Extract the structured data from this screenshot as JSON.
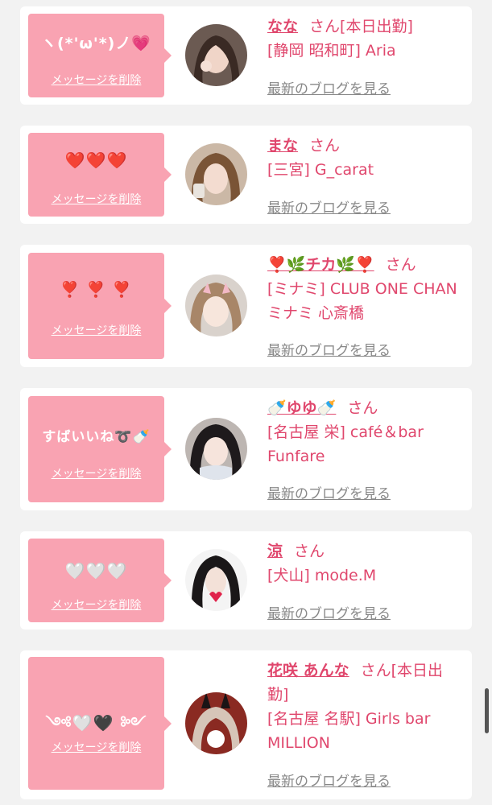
{
  "cards": [
    {
      "message": "ヽ(*'ω'*)ノ💗",
      "delete_label": "メッセージを削除",
      "name": "なな",
      "honorific": "さん",
      "status": "[本日出勤]",
      "shop": "[静岡 昭和町] Aria",
      "blog_label": "最新のブログを見る",
      "avatar_icon": "avatar-photo"
    },
    {
      "message": "❤️❤️❤️",
      "delete_label": "メッセージを削除",
      "name": "まな",
      "honorific": "さん",
      "status": "",
      "shop": "[三宮] G_carat",
      "blog_label": "最新のブログを見る",
      "avatar_icon": "avatar-photo"
    },
    {
      "message": "❣️ ❣️ ❣️",
      "delete_label": "メッセージを削除",
      "name": "❣️🌿チカ🌿❣️",
      "honorific": "さん",
      "status": "",
      "shop": "[ミナミ] CLUB ONE CHAN ミナミ 心斎橋",
      "blog_label": "最新のブログを見る",
      "avatar_icon": "avatar-photo"
    },
    {
      "message": "すばいいね➰🍼",
      "delete_label": "メッセージを削除",
      "name": "🍼ゆゆ🍼",
      "honorific": "さん",
      "status": "",
      "shop": "[名古屋 栄] café＆bar Funfare",
      "blog_label": "最新のブログを見る",
      "avatar_icon": "avatar-photo"
    },
    {
      "message": "🤍🤍🤍",
      "delete_label": "メッセージを削除",
      "name": "涼",
      "honorific": "さん",
      "status": "",
      "shop": "[犬山] mode.M",
      "blog_label": "最新のブログを見る",
      "avatar_icon": "avatar-photo"
    },
    {
      "message": "༺🤍🖤 ༻",
      "delete_label": "メッセージを削除",
      "name": "花咲 あんな",
      "honorific": "さん",
      "status": "[本日出勤]",
      "shop": "[名古屋 名駅] Girls bar MILLION",
      "blog_label": "最新のブログを見る",
      "avatar_icon": "avatar-photo"
    }
  ],
  "colors": {
    "bubble": "#f9a3b2",
    "name": "#e0476d",
    "blog_link": "#888888",
    "background": "#f2f2f2"
  }
}
